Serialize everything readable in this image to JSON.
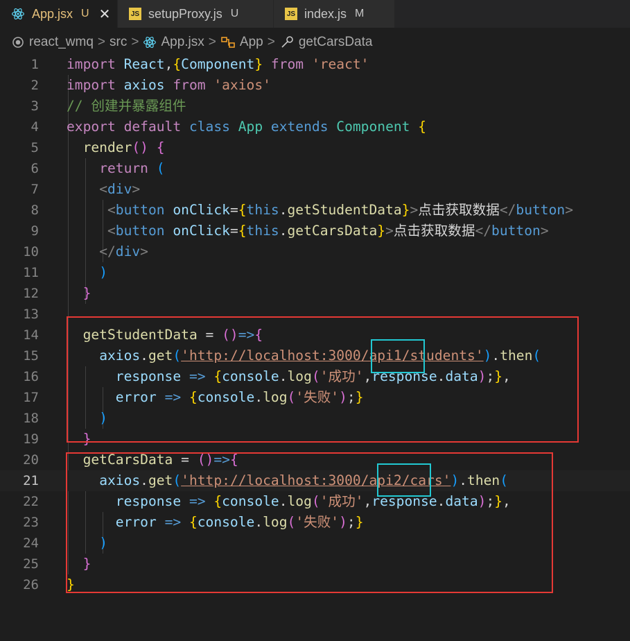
{
  "tabs": [
    {
      "name": "App.jsx",
      "status": "U",
      "icon": "react-icon",
      "active": true,
      "close": "✕"
    },
    {
      "name": "setupProxy.js",
      "status": "U",
      "icon": "js-icon"
    },
    {
      "name": "index.js",
      "status": "M",
      "icon": "js-icon"
    }
  ],
  "js_icon_text": "JS",
  "breadcrumb": {
    "items": [
      "react_wmq",
      "src",
      "App.jsx",
      "App",
      "getCarsData"
    ],
    "separator": ">"
  },
  "editor": {
    "current_line": 21,
    "lines": [
      {
        "n": "1",
        "tokens": [
          [
            "kw",
            "import"
          ],
          [
            "txt",
            " "
          ],
          [
            "var",
            "React"
          ],
          [
            "txt",
            ","
          ],
          [
            "b1",
            "{"
          ],
          [
            "var",
            "Component"
          ],
          [
            "b1",
            "}"
          ],
          [
            "txt",
            " "
          ],
          [
            "kw",
            "from"
          ],
          [
            "txt",
            " "
          ],
          [
            "str",
            "'react'"
          ]
        ]
      },
      {
        "n": "2",
        "tokens": [
          [
            "kw",
            "import"
          ],
          [
            "txt",
            " "
          ],
          [
            "var",
            "axios"
          ],
          [
            "txt",
            " "
          ],
          [
            "kw",
            "from"
          ],
          [
            "txt",
            " "
          ],
          [
            "str",
            "'axios'"
          ]
        ]
      },
      {
        "n": "3",
        "tokens": [
          [
            "cm",
            "// 创建并暴露组件"
          ]
        ]
      },
      {
        "n": "4",
        "tokens": [
          [
            "kw",
            "export"
          ],
          [
            "txt",
            " "
          ],
          [
            "kw",
            "default"
          ],
          [
            "txt",
            " "
          ],
          [
            "kw2",
            "class"
          ],
          [
            "txt",
            " "
          ],
          [
            "cls",
            "App"
          ],
          [
            "txt",
            " "
          ],
          [
            "kw2",
            "extends"
          ],
          [
            "txt",
            " "
          ],
          [
            "cls",
            "Component"
          ],
          [
            "txt",
            " "
          ],
          [
            "b1",
            "{"
          ]
        ]
      },
      {
        "n": "5",
        "tokens": [
          [
            "txt",
            "  "
          ],
          [
            "fn",
            "render"
          ],
          [
            "b2",
            "()"
          ],
          [
            "txt",
            " "
          ],
          [
            "b2",
            "{"
          ]
        ]
      },
      {
        "n": "6",
        "tokens": [
          [
            "txt",
            "    "
          ],
          [
            "kw",
            "return"
          ],
          [
            "txt",
            " "
          ],
          [
            "b3",
            "("
          ]
        ]
      },
      {
        "n": "7",
        "tokens": [
          [
            "txt",
            "    "
          ],
          [
            "punc",
            "<"
          ],
          [
            "tag",
            "div"
          ],
          [
            "punc",
            ">"
          ]
        ]
      },
      {
        "n": "8",
        "tokens": [
          [
            "txt",
            "     "
          ],
          [
            "punc",
            "<"
          ],
          [
            "tag",
            "button"
          ],
          [
            "txt",
            " "
          ],
          [
            "var",
            "onClick"
          ],
          [
            "txt",
            "="
          ],
          [
            "b1",
            "{"
          ],
          [
            "kw2",
            "this"
          ],
          [
            "txt",
            "."
          ],
          [
            "fn",
            "getStudentData"
          ],
          [
            "b1",
            "}"
          ],
          [
            "punc",
            ">"
          ],
          [
            "txt",
            "点击获取数据"
          ],
          [
            "punc",
            "</"
          ],
          [
            "tag",
            "button"
          ],
          [
            "punc",
            ">"
          ]
        ]
      },
      {
        "n": "9",
        "tokens": [
          [
            "txt",
            "     "
          ],
          [
            "punc",
            "<"
          ],
          [
            "tag",
            "button"
          ],
          [
            "txt",
            " "
          ],
          [
            "var",
            "onClick"
          ],
          [
            "txt",
            "="
          ],
          [
            "b1",
            "{"
          ],
          [
            "kw2",
            "this"
          ],
          [
            "txt",
            "."
          ],
          [
            "fn",
            "getCarsData"
          ],
          [
            "b1",
            "}"
          ],
          [
            "punc",
            ">"
          ],
          [
            "txt",
            "点击获取数据"
          ],
          [
            "punc",
            "</"
          ],
          [
            "tag",
            "button"
          ],
          [
            "punc",
            ">"
          ]
        ]
      },
      {
        "n": "10",
        "tokens": [
          [
            "txt",
            "    "
          ],
          [
            "punc",
            "</"
          ],
          [
            "tag",
            "div"
          ],
          [
            "punc",
            ">"
          ]
        ]
      },
      {
        "n": "11",
        "tokens": [
          [
            "txt",
            "    "
          ],
          [
            "b3",
            ")"
          ]
        ]
      },
      {
        "n": "12",
        "tokens": [
          [
            "txt",
            "  "
          ],
          [
            "b2",
            "}"
          ]
        ]
      },
      {
        "n": "13",
        "tokens": []
      },
      {
        "n": "14",
        "tokens": [
          [
            "txt",
            "  "
          ],
          [
            "fn",
            "getStudentData"
          ],
          [
            "txt",
            " = "
          ],
          [
            "b2",
            "()"
          ],
          [
            "kw2",
            "=>"
          ],
          [
            "b2",
            "{"
          ]
        ]
      },
      {
        "n": "15",
        "tokens": [
          [
            "txt",
            "    "
          ],
          [
            "var",
            "axios"
          ],
          [
            "txt",
            "."
          ],
          [
            "fn",
            "get"
          ],
          [
            "b3",
            "("
          ],
          [
            "str",
            "'http://localhost:3000/api1/students'"
          ],
          [
            "b3",
            ")"
          ],
          [
            "txt",
            "."
          ],
          [
            "fn",
            "then"
          ],
          [
            "b3",
            "("
          ]
        ]
      },
      {
        "n": "16",
        "tokens": [
          [
            "txt",
            "      "
          ],
          [
            "var",
            "response"
          ],
          [
            "txt",
            " "
          ],
          [
            "kw2",
            "=>"
          ],
          [
            "txt",
            " "
          ],
          [
            "b1",
            "{"
          ],
          [
            "var",
            "console"
          ],
          [
            "txt",
            "."
          ],
          [
            "fn",
            "log"
          ],
          [
            "b2",
            "("
          ],
          [
            "str",
            "'成功'"
          ],
          [
            "txt",
            ","
          ],
          [
            "var",
            "response"
          ],
          [
            "txt",
            "."
          ],
          [
            "var",
            "data"
          ],
          [
            "b2",
            ")"
          ],
          [
            "txt",
            ";"
          ],
          [
            "b1",
            "}"
          ],
          [
            "txt",
            ","
          ]
        ]
      },
      {
        "n": "17",
        "tokens": [
          [
            "txt",
            "      "
          ],
          [
            "var",
            "error"
          ],
          [
            "txt",
            " "
          ],
          [
            "kw2",
            "=>"
          ],
          [
            "txt",
            " "
          ],
          [
            "b1",
            "{"
          ],
          [
            "var",
            "console"
          ],
          [
            "txt",
            "."
          ],
          [
            "fn",
            "log"
          ],
          [
            "b2",
            "("
          ],
          [
            "str",
            "'失败'"
          ],
          [
            "b2",
            ")"
          ],
          [
            "txt",
            ";"
          ],
          [
            "b1",
            "}"
          ]
        ]
      },
      {
        "n": "18",
        "tokens": [
          [
            "txt",
            "    "
          ],
          [
            "b3",
            ")"
          ]
        ]
      },
      {
        "n": "19",
        "tokens": [
          [
            "txt",
            "  "
          ],
          [
            "b2",
            "}"
          ]
        ]
      },
      {
        "n": "20",
        "tokens": [
          [
            "txt",
            "  "
          ],
          [
            "fn",
            "getCarsData"
          ],
          [
            "txt",
            " = "
          ],
          [
            "b2",
            "()"
          ],
          [
            "kw2",
            "=>"
          ],
          [
            "b2",
            "{"
          ]
        ]
      },
      {
        "n": "21",
        "tokens": [
          [
            "txt",
            "    "
          ],
          [
            "var",
            "axios"
          ],
          [
            "txt",
            "."
          ],
          [
            "fn",
            "get"
          ],
          [
            "b3",
            "("
          ],
          [
            "str",
            "'http://localhost:3000/api2/cars'"
          ],
          [
            "b3",
            ")"
          ],
          [
            "txt",
            "."
          ],
          [
            "fn",
            "then"
          ],
          [
            "b3",
            "("
          ]
        ]
      },
      {
        "n": "22",
        "tokens": [
          [
            "txt",
            "      "
          ],
          [
            "var",
            "response"
          ],
          [
            "txt",
            " "
          ],
          [
            "kw2",
            "=>"
          ],
          [
            "txt",
            " "
          ],
          [
            "b1",
            "{"
          ],
          [
            "var",
            "console"
          ],
          [
            "txt",
            "."
          ],
          [
            "fn",
            "log"
          ],
          [
            "b2",
            "("
          ],
          [
            "str",
            "'成功'"
          ],
          [
            "txt",
            ","
          ],
          [
            "var",
            "response"
          ],
          [
            "txt",
            "."
          ],
          [
            "var",
            "data"
          ],
          [
            "b2",
            ")"
          ],
          [
            "txt",
            ";"
          ],
          [
            "b1",
            "}"
          ],
          [
            "txt",
            ","
          ]
        ]
      },
      {
        "n": "23",
        "tokens": [
          [
            "txt",
            "      "
          ],
          [
            "var",
            "error"
          ],
          [
            "txt",
            " "
          ],
          [
            "kw2",
            "=>"
          ],
          [
            "txt",
            " "
          ],
          [
            "b1",
            "{"
          ],
          [
            "var",
            "console"
          ],
          [
            "txt",
            "."
          ],
          [
            "fn",
            "log"
          ],
          [
            "b2",
            "("
          ],
          [
            "str",
            "'失败'"
          ],
          [
            "b2",
            ")"
          ],
          [
            "txt",
            ";"
          ],
          [
            "b1",
            "}"
          ]
        ]
      },
      {
        "n": "24",
        "tokens": [
          [
            "txt",
            "    "
          ],
          [
            "b3",
            ")"
          ]
        ]
      },
      {
        "n": "25",
        "tokens": [
          [
            "txt",
            "  "
          ],
          [
            "b2",
            "}"
          ]
        ]
      },
      {
        "n": "26",
        "tokens": [
          [
            "b1",
            "}"
          ]
        ]
      }
    ]
  },
  "colors": {
    "annotation_red": "#e53935",
    "annotation_cyan": "#22c8d2"
  }
}
